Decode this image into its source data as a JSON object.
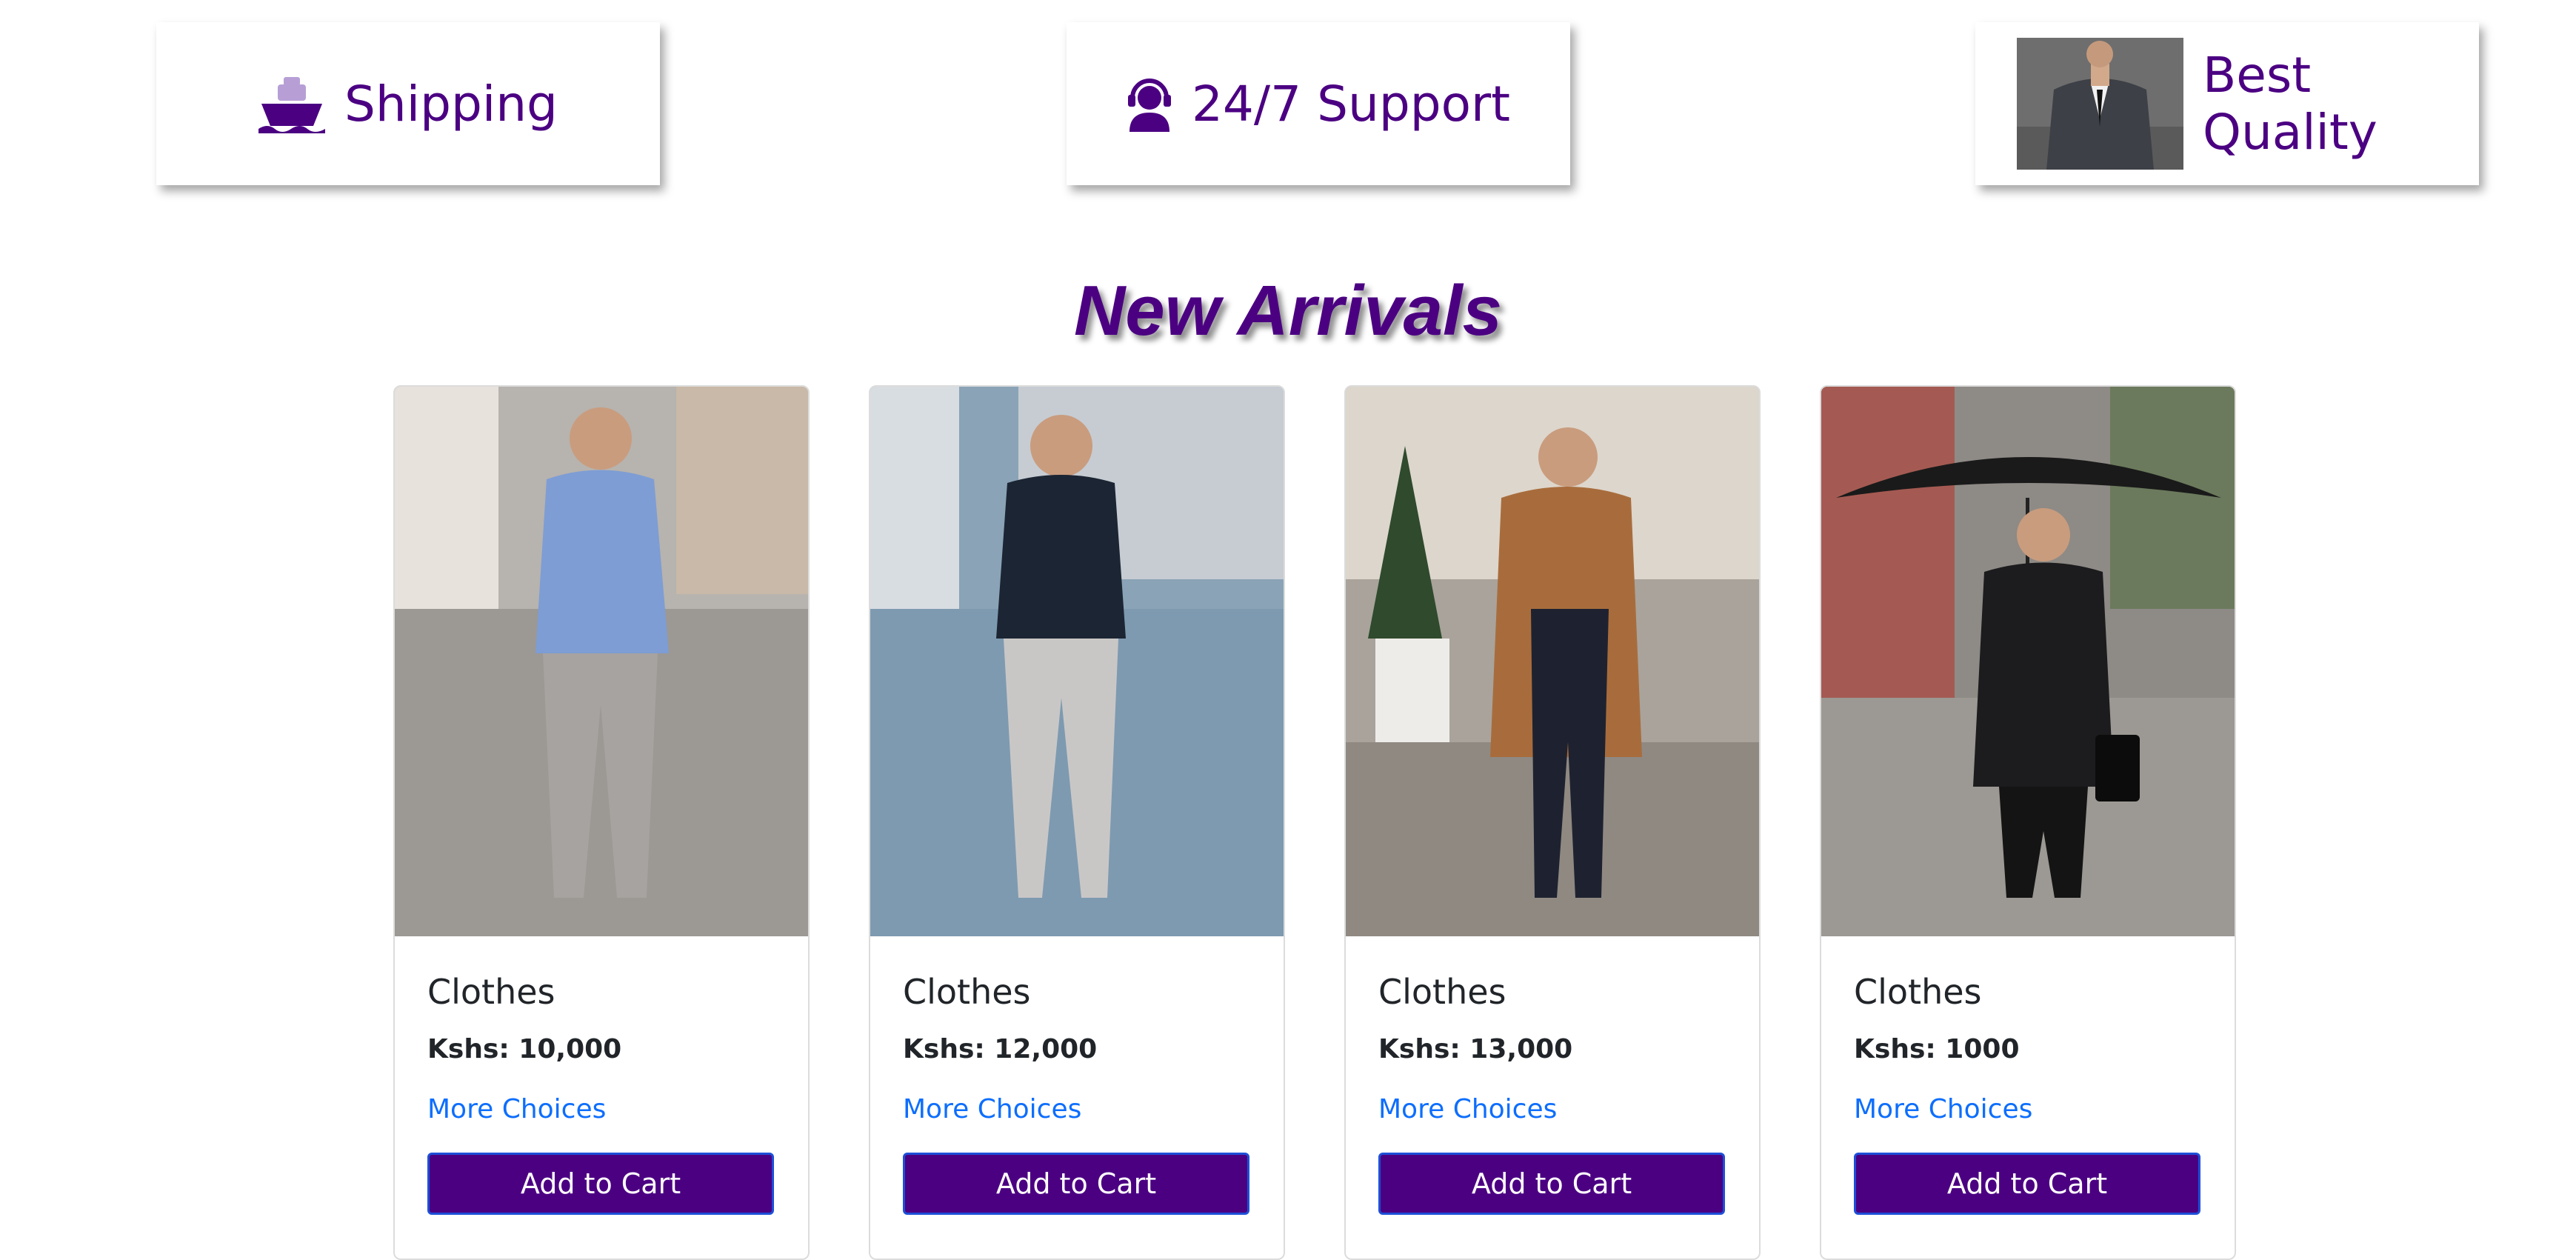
{
  "features": [
    {
      "label": "Shipping",
      "icon": "ship-icon"
    },
    {
      "label": "24/7 Support",
      "icon": "headset-icon"
    },
    {
      "label": "Best Quality",
      "icon": "suit-thumbnail"
    }
  ],
  "section_title": "New Arrivals",
  "products": [
    {
      "title": "Clothes",
      "price": "Kshs: 10,000",
      "link": "More Choices",
      "button": "Add to Cart"
    },
    {
      "title": "Clothes",
      "price": "Kshs: 12,000",
      "link": "More Choices",
      "button": "Add to Cart"
    },
    {
      "title": "Clothes",
      "price": "Kshs: 13,000",
      "link": "More Choices",
      "button": "Add to Cart"
    },
    {
      "title": "Clothes",
      "price": "Kshs: 1000",
      "link": "More Choices",
      "button": "Add to Cart"
    }
  ],
  "colors": {
    "brand": "#4b0082",
    "link": "#0d6efd",
    "button_border": "#1d4fd8"
  }
}
